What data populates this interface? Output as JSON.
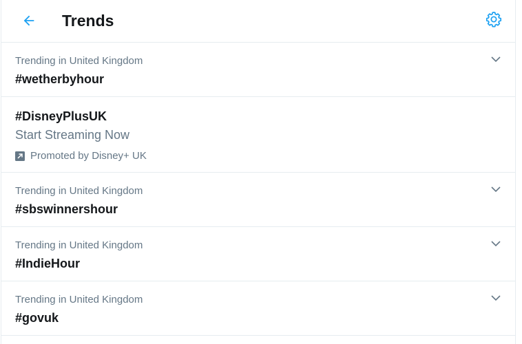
{
  "header": {
    "title": "Trends"
  },
  "trends": [
    {
      "context": "Trending in United Kingdom",
      "tag": "#wetherbyhour"
    },
    {
      "tag": "#DisneyPlusUK",
      "subtitle": "Start Streaming Now",
      "promoted_by": "Promoted by Disney+ UK"
    },
    {
      "context": "Trending in United Kingdom",
      "tag": "#sbswinnershour"
    },
    {
      "context": "Trending in United Kingdom",
      "tag": "#IndieHour"
    },
    {
      "context": "Trending in United Kingdom",
      "tag": "#govuk"
    }
  ],
  "colors": {
    "accent": "#1da1f2",
    "text_primary": "#14171a",
    "text_secondary": "#657786",
    "border": "#e6ecf0"
  },
  "icons": {
    "back": "arrow-left-icon",
    "settings": "gear-icon",
    "more": "chevron-down-icon",
    "promoted": "promoted-arrow-icon"
  }
}
